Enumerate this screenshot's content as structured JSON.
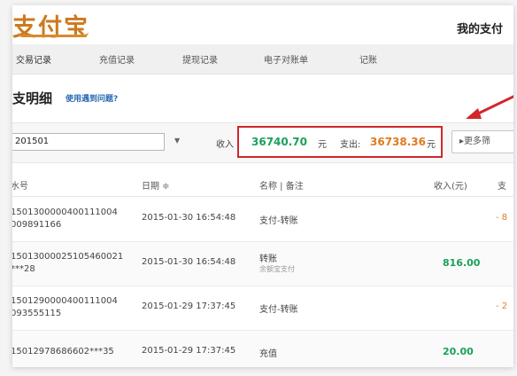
{
  "header": {
    "logo_text": "支付宝",
    "user_title": "我的支付"
  },
  "tabs": [
    {
      "label": "交易记录"
    },
    {
      "label": "充值记录"
    },
    {
      "label": "提现记录"
    },
    {
      "label": "电子对账单"
    },
    {
      "label": "记账"
    }
  ],
  "page": {
    "title": "支明细",
    "help_link": "使用遇到问题?"
  },
  "filter": {
    "date_value": "201501",
    "income_label": "收入",
    "income_value": "36740.70",
    "income_unit": "元",
    "expense_label": "支出:",
    "expense_value": "36738.36",
    "expense_unit": "元",
    "more_button": "▸更多筛"
  },
  "table": {
    "headers": {
      "serial": "水号",
      "date": "日期 ≑",
      "name": "名称 | 备注",
      "income": "收入(元)",
      "expense": "支"
    },
    "rows": [
      {
        "serial_1": "1501300000400111004",
        "serial_2": "009891166",
        "date": "2015-01-30 16:54:48",
        "name": "支付-转账",
        "note": "",
        "income": "",
        "expense": "- 8"
      },
      {
        "serial_1": "15013000025105460021",
        "serial_2": "***28",
        "date": "2015-01-30 16:54:48",
        "name": "转账",
        "note": "余额宝支付",
        "income": "816.00",
        "expense": ""
      },
      {
        "serial_1": "1501290000400111004",
        "serial_2": "093555115",
        "date": "2015-01-29 17:37:45",
        "name": "支付-转账",
        "note": "",
        "income": "",
        "expense": "- 2"
      },
      {
        "serial_1": "15012978686602***35",
        "serial_2": "",
        "date": "2015-01-29 17:37:45",
        "name": "充值",
        "note": "",
        "income": "20.00",
        "expense": ""
      }
    ]
  },
  "colors": {
    "highlight_border": "#d2262a",
    "income_green": "#1aa05a",
    "expense_orange": "#e07b1e",
    "logo_orange": "#cc7a1e"
  }
}
